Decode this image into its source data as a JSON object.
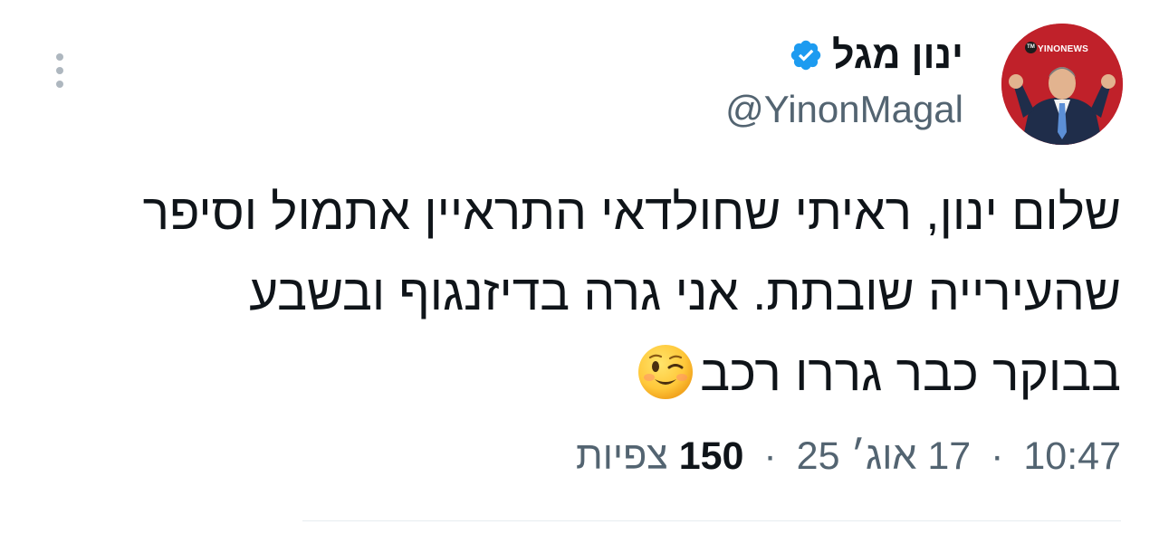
{
  "author": {
    "display_name": "ינון מגל",
    "handle": "@YinonMagal",
    "verified": true,
    "avatar_brand": "YINONEWS",
    "avatar_tag": "TM"
  },
  "tweet": {
    "lines": [
      "שלום ינון, ראיתי שחולדאי התראיין אתמול וסיפר",
      "שהעירייה שובתת. אני גרה בדיזנגוף ובשבע",
      "בבוקר כבר גררו רכב"
    ],
    "trailing_emoji": "winking-face"
  },
  "meta": {
    "time": "10:47",
    "date": "17 אוג׳ 25",
    "views_count": "150",
    "views_label": "צפיות",
    "separator": "·"
  },
  "colors": {
    "text": "#0f1419",
    "secondary": "#536471",
    "verified": "#1d9bf0",
    "avatar_bg": "#c0212a"
  },
  "icons": [
    "verified-badge-icon",
    "more-options-icon"
  ]
}
